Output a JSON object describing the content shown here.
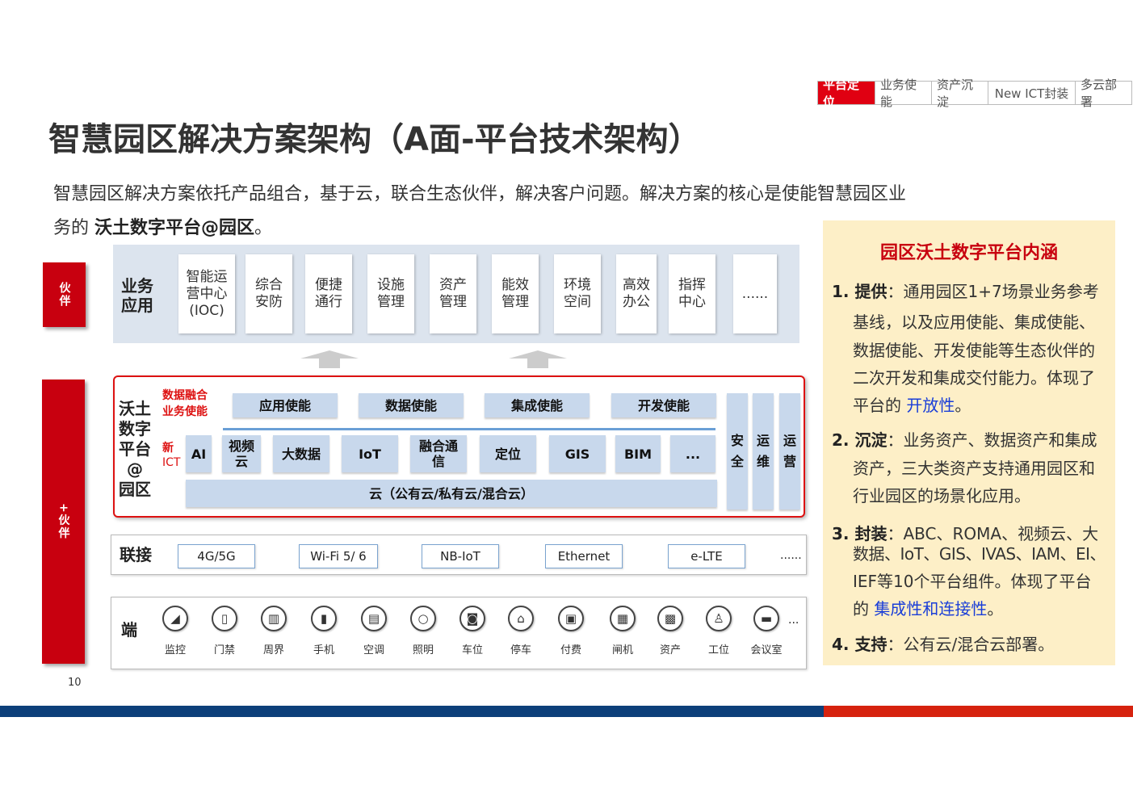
{
  "nav": {
    "tabs": [
      "平台定位",
      "业务使能",
      "资产沉淀",
      "New ICT封装",
      "多云部署"
    ]
  },
  "title": "智慧园区解决方案架构（A面-平台技术架构）",
  "intro": {
    "line1": "智慧园区解决方案依托产品组合，基于云，联合生态伙伴，解决客户问题。解决方案的核心是使能智慧园区业",
    "line2_prefix": "务的 ",
    "line2_bold": "沃土数字平台@园区",
    "line2_suffix": "。"
  },
  "left_labels": {
    "partner_top": "伙伴",
    "partner_bottom": "+伙伴"
  },
  "business": {
    "label_l1": "业务",
    "label_l2": "应用",
    "apps": [
      {
        "l1": "智能运",
        "l2": "营中心",
        "l3": "(IOC)"
      },
      {
        "l1": "综合",
        "l2": "安防",
        "l3": ""
      },
      {
        "l1": "便捷",
        "l2": "通行",
        "l3": ""
      },
      {
        "l1": "设施",
        "l2": "管理",
        "l3": ""
      },
      {
        "l1": "资产",
        "l2": "管理",
        "l3": ""
      },
      {
        "l1": "能效",
        "l2": "管理",
        "l3": ""
      },
      {
        "l1": "环境",
        "l2": "空间",
        "l3": ""
      },
      {
        "l1": "高效",
        "l2": "办公",
        "l3": ""
      },
      {
        "l1": "指挥",
        "l2": "中心",
        "l3": ""
      },
      {
        "l1": "......",
        "l2": "",
        "l3": ""
      }
    ]
  },
  "platform": {
    "label": [
      "沃土",
      "数字",
      "平台",
      "@",
      "园区"
    ],
    "enable_tag_l1": "数据融合",
    "enable_tag_l2": "业务使能",
    "enablers": [
      "应用使能",
      "数据使能",
      "集成使能",
      "开发使能"
    ],
    "ict_tag_l1": "新",
    "ict_tag_l2": "ICT",
    "ict": [
      {
        "l1": "AI",
        "l2": ""
      },
      {
        "l1": "视频",
        "l2": "云"
      },
      {
        "l1": "大数据",
        "l2": ""
      },
      {
        "l1": "IoT",
        "l2": ""
      },
      {
        "l1": "融合通",
        "l2": "信"
      },
      {
        "l1": "定位",
        "l2": ""
      },
      {
        "l1": "GIS",
        "l2": ""
      },
      {
        "l1": "BIM",
        "l2": ""
      },
      {
        "l1": "...",
        "l2": ""
      }
    ],
    "cloud": "云（公有云/私有云/混合云）",
    "side": [
      {
        "l1": "安",
        "l2": "全"
      },
      {
        "l1": "运",
        "l2": "维"
      },
      {
        "l1": "运",
        "l2": "营"
      }
    ]
  },
  "connect": {
    "label": "联接",
    "items": [
      "4G/5G",
      "Wi-Fi 5/ 6",
      "NB-IoT",
      "Ethernet",
      "e-LTE"
    ],
    "more": "......"
  },
  "devices": {
    "label": "端",
    "items": [
      "监控",
      "门禁",
      "周界",
      "手机",
      "空调",
      "照明",
      "车位",
      "停车",
      "付费",
      "闸机",
      "资产",
      "工位",
      "会议室"
    ],
    "icons": [
      "camera-icon",
      "door-icon",
      "fence-icon",
      "phone-icon",
      "ac-icon",
      "bulb-icon",
      "car-icon",
      "parking-icon",
      "pay-icon",
      "gate-icon",
      "asset-icon",
      "workstation-icon",
      "meeting-icon"
    ],
    "more": "..."
  },
  "panel": {
    "title": "园区沃土数字平台内涵",
    "p1_num": "1. ",
    "p1_head": "提供",
    "p1_l1": "：通用园区1+7场景业务参考",
    "p1_l2": "基线，以及应用使能、集成使能、",
    "p1_l3": "数据使能、开发使能等生态伙伴的",
    "p1_l4": "二次开发和集成交付能力。体现了",
    "p1_l5a": "平台的 ",
    "p1_l5b": "开放性",
    "p1_l5c": "。",
    "p2_num": "2. ",
    "p2_head": "沉淀",
    "p2_l1": "：业务资产、数据资产和集成",
    "p2_l2": "资产，三大类资产支持通用园区和",
    "p2_l3": "行业园区的场景化应用。",
    "p3_num": "3. ",
    "p3_head": "封装",
    "p3_l1": "：ABC、ROMA、视频云、大",
    "p3_l2": "数据、IoT、GIS、IVAS、IAM、EI、",
    "p3_l3": "IEF等10个平台组件。体现了平台",
    "p3_l4a": "的 ",
    "p3_l4b": "集成性和连接性",
    "p3_l4c": "。",
    "p4_num": "4. ",
    "p4_head": "支持",
    "p4_l1": "：公有云/混合云部署。"
  },
  "page_number": "10"
}
